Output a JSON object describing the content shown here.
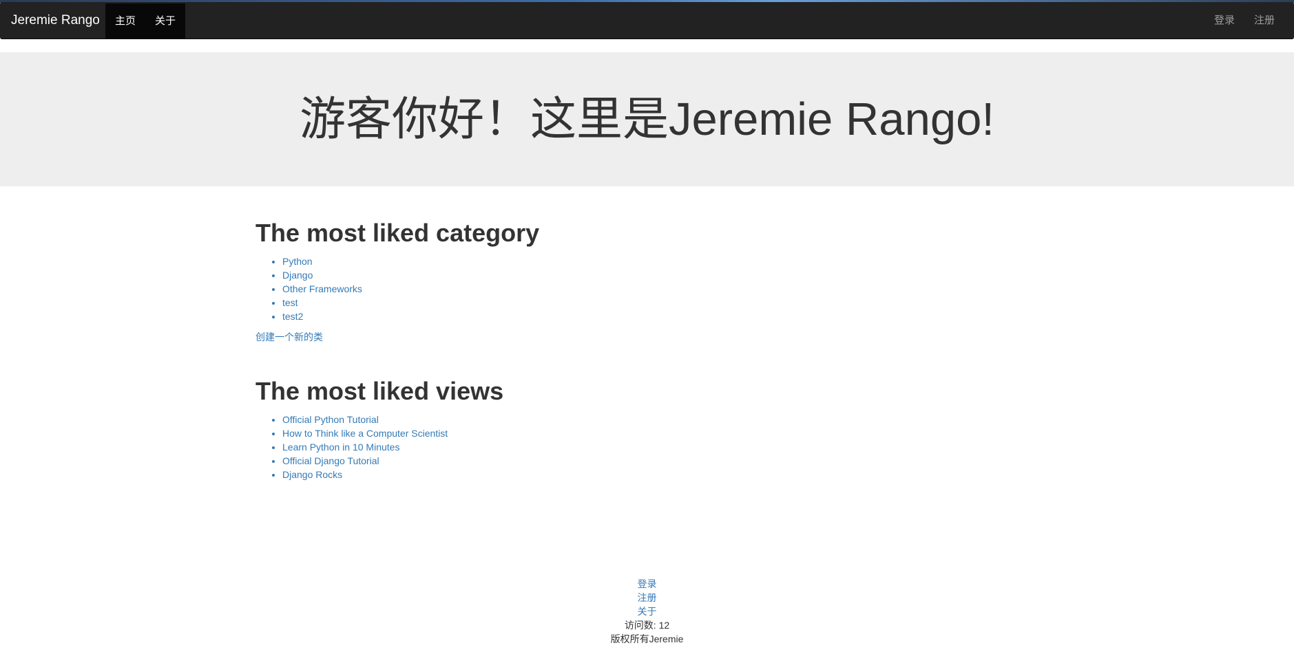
{
  "navbar": {
    "brand": "Jeremie Rango",
    "left_items": [
      "主页",
      "关于"
    ],
    "right_items": [
      "登录",
      "注册"
    ]
  },
  "jumbotron": {
    "title": "游客你好！这里是Jeremie Rango!"
  },
  "categories": {
    "heading": "The most liked category",
    "items": [
      "Python",
      "Django",
      "Other Frameworks",
      "test",
      "test2"
    ],
    "create_link": "创建一个新的类"
  },
  "views": {
    "heading": "The most liked views",
    "items": [
      "Official Python Tutorial",
      "How to Think like a Computer Scientist",
      "Learn Python in 10 Minutes",
      "Official Django Tutorial",
      "Django Rocks"
    ]
  },
  "footer": {
    "links": [
      "登录",
      "注册",
      "关于"
    ],
    "visits": "访问数: 12",
    "copyright": "版权所有Jeremie"
  },
  "colors": {
    "navbar_bg": "#222222",
    "active_nav_bg": "#080808",
    "jumbotron_bg": "#eeeeee",
    "link": "#337ab7"
  }
}
